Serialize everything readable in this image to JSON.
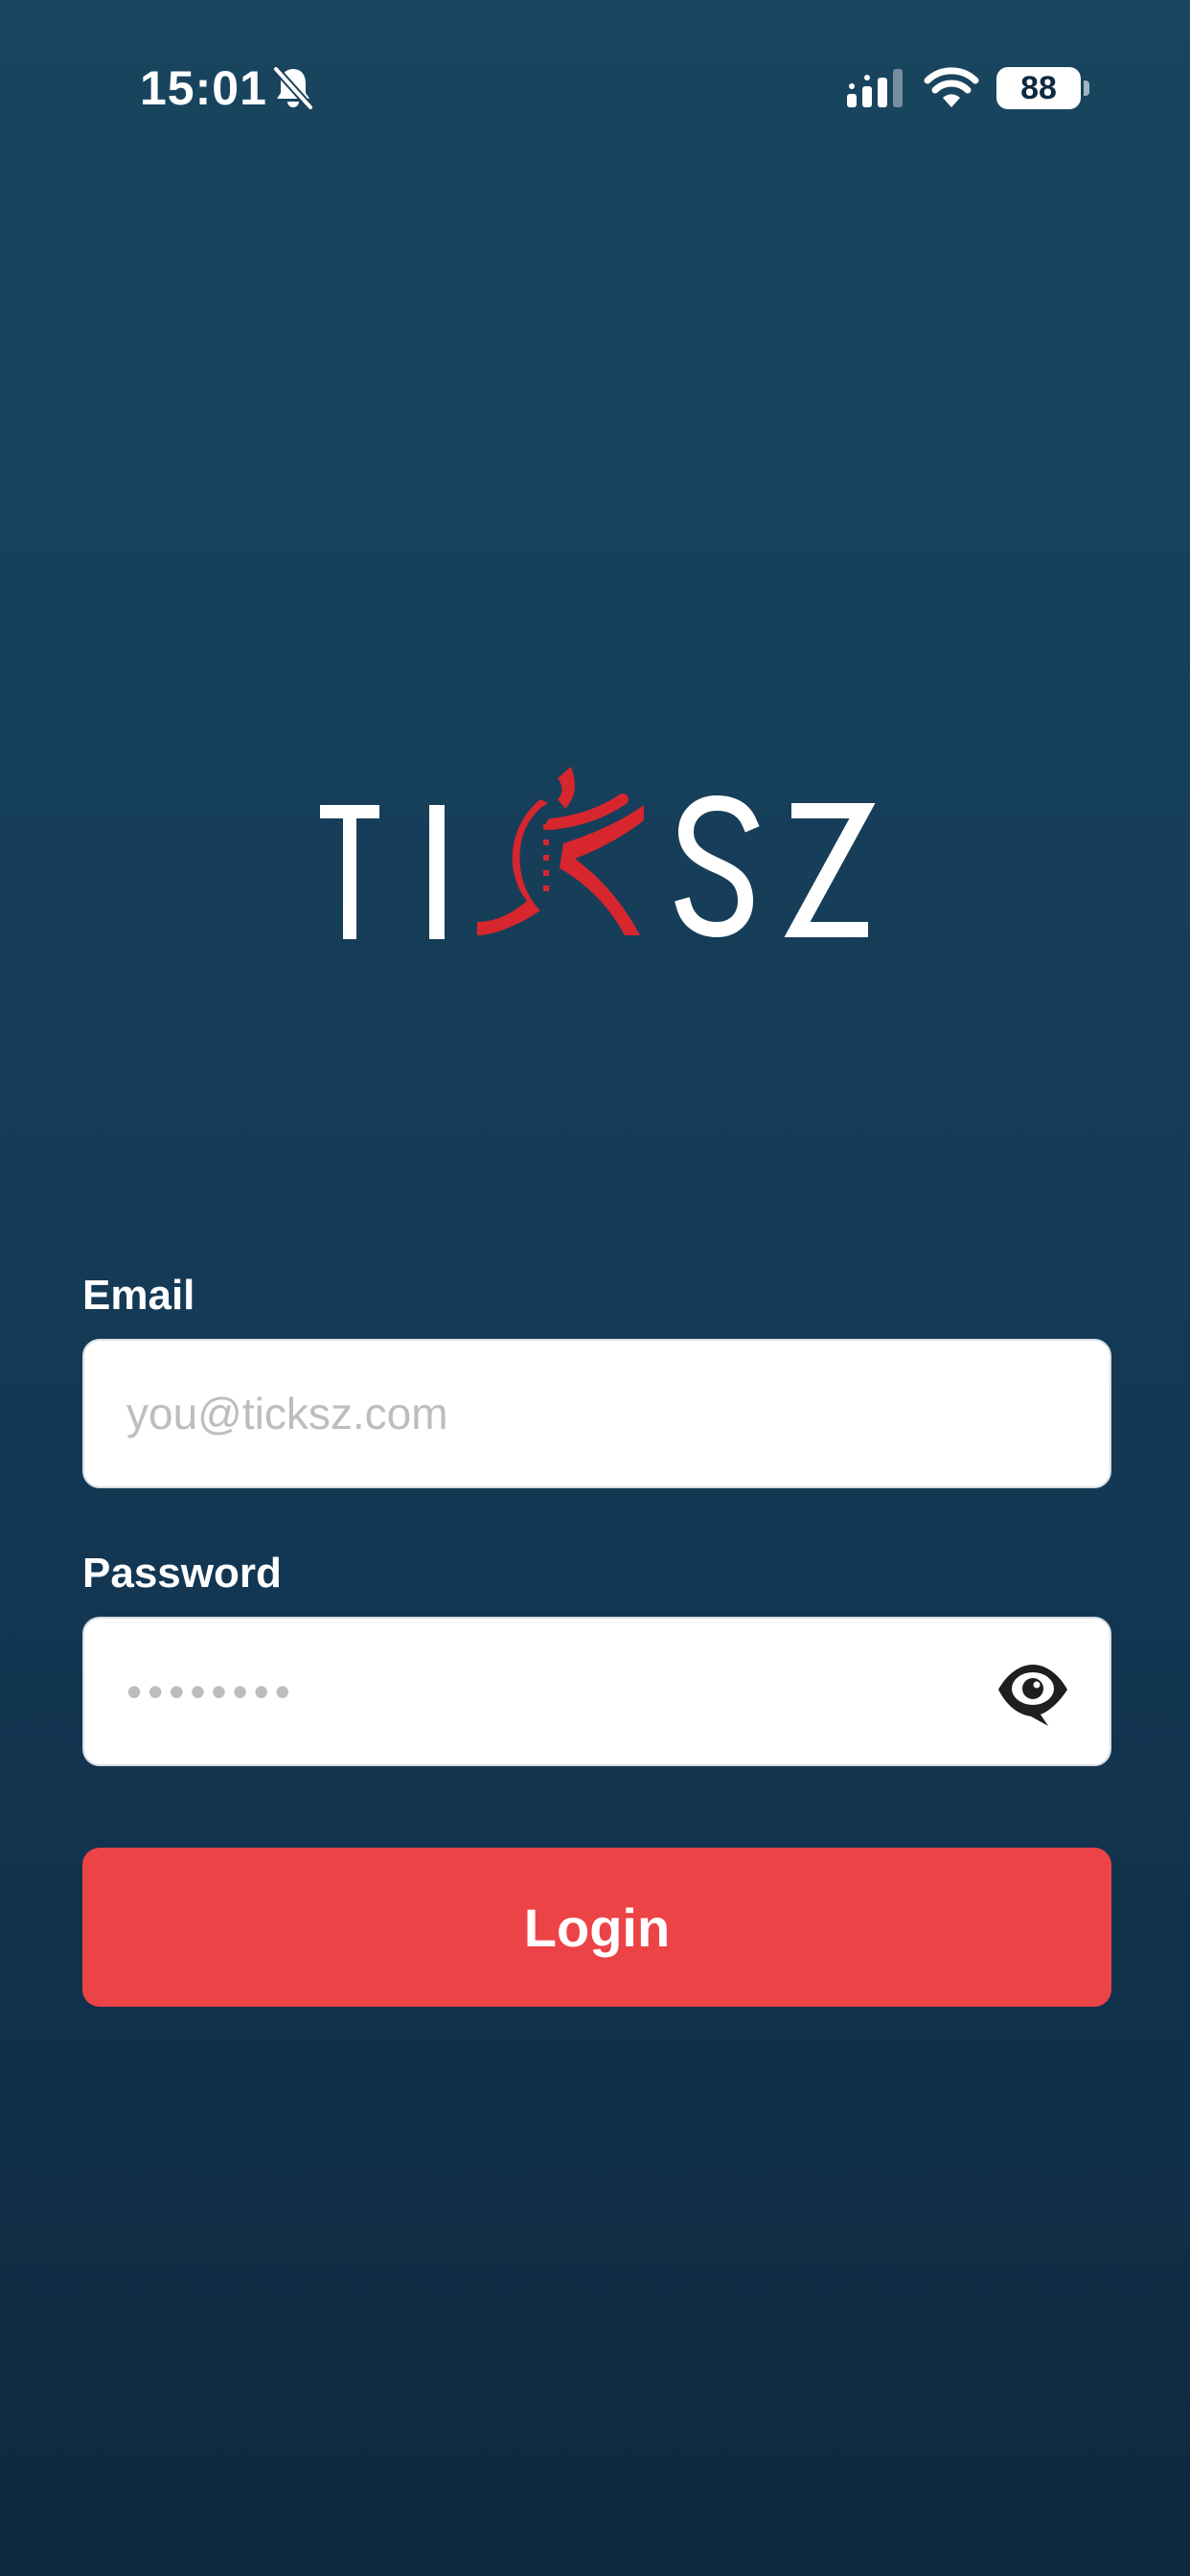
{
  "status_bar": {
    "time": "15:01",
    "battery_level": "88",
    "icons": [
      "bell-off-icon",
      "signal-icon",
      "wifi-icon",
      "battery-icon"
    ]
  },
  "logo": {
    "text": "TICKSZ",
    "accent_color": "#D7262E"
  },
  "form": {
    "email": {
      "label": "Email",
      "placeholder": "you@ticksz.com",
      "value": ""
    },
    "password": {
      "label": "Password",
      "placeholder": "••••••••",
      "value": "",
      "toggle_icon": "eye-icon"
    },
    "login_label": "Login"
  },
  "colors": {
    "background_top": "#19455F",
    "background_bottom": "#0E2940",
    "button": "#EC4347",
    "input_bg": "#FFFFFF"
  }
}
